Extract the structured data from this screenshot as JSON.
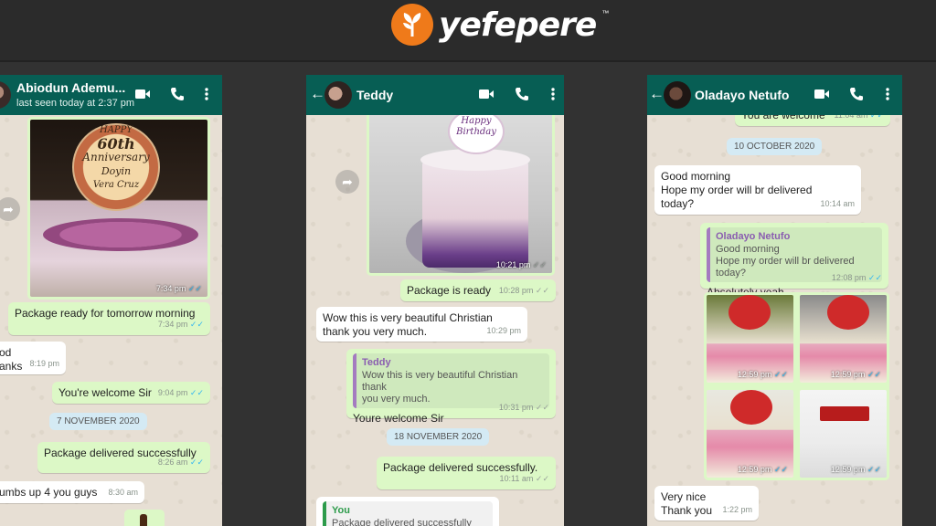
{
  "brand": {
    "name": "yefepere",
    "tm": "™"
  },
  "chats": {
    "left": {
      "name": "Abiodun Ademu...",
      "status": "last seen today at 2:37 pm",
      "photo_time": "7:34 pm",
      "photo_caption_lines": [
        "HAPPY",
        "60th",
        "Anniversary",
        "Doyin",
        "Vera Cruz"
      ],
      "msgs": {
        "m1": {
          "text": "Package ready for tomorrow morning",
          "time": "7:34 pm"
        },
        "m2a": {
          "text": "od"
        },
        "m2b": {
          "text": "anks",
          "time": "8:19 pm"
        },
        "m3": {
          "text": "You're welcome Sir",
          "time": "9:04 pm"
        },
        "date1": "7 NOVEMBER 2020",
        "m4": {
          "text": "Package delivered successfully",
          "time": "8:26 am"
        },
        "m5": {
          "text": "umbs up 4 you guys",
          "time": "8:30 am"
        }
      }
    },
    "middle": {
      "name": "Teddy",
      "photo_time": "10:21 pm",
      "photo_caption_lines": [
        "Happy",
        "Birthday"
      ],
      "msgs": {
        "m1": {
          "text": "Package is ready",
          "time": "10:28 pm"
        },
        "m2a": {
          "text": "Wow this is very beautiful Christian"
        },
        "m2b": {
          "text": "thank you very much.",
          "time": "10:29 pm"
        },
        "m3": {
          "quote_name": "Teddy",
          "quote_line1": "Wow this is very beautiful Christian thank",
          "quote_line2": "you very much.",
          "text": "Youre welcome Sir",
          "time": "10:31 pm"
        },
        "date1": "18 NOVEMBER 2020",
        "m4": {
          "text": "Package delivered successfully.",
          "time": "10:11 am"
        },
        "m5": {
          "quote_name": "You",
          "quote_text": "Package delivered successfully"
        }
      }
    },
    "right": {
      "name": "Oladayo Netufo",
      "msgs": {
        "m0": {
          "text": "You are welcome",
          "time": "11:04 am"
        },
        "date1": "10 OCTOBER 2020",
        "m1": {
          "line1": "Good morning",
          "line2": "Hope my order will br delivered",
          "line3": "today?",
          "time": "10:14 am"
        },
        "m2": {
          "quote_name": "Oladayo Netufo",
          "quote_line1": "Good morning",
          "quote_line2": "Hope my order will br delivered today?",
          "text": "Absolutely yeah",
          "time": "12:08 pm"
        },
        "grid_times": [
          "12:59 pm",
          "12:59 pm",
          "12:59 pm",
          "12:59 pm"
        ],
        "m3": {
          "line1": "Very nice",
          "line2": "Thank you",
          "time": "1:22 pm"
        }
      }
    }
  },
  "icons": {
    "video": "video-call-icon",
    "phone": "voice-call-icon",
    "menu": "more-vert-icon",
    "back": "back-arrow-icon",
    "forward": "forward-icon",
    "ticks": "read-ticks-icon"
  },
  "colors": {
    "header": "#075e54",
    "outgoing": "#dcf8c6",
    "incoming": "#ffffff",
    "brand": "#ef7a1a",
    "read_ticks": "#34b7f1"
  }
}
